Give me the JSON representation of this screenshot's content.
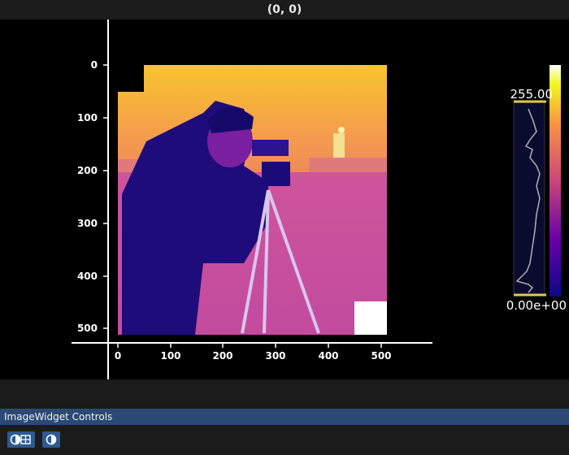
{
  "window": {
    "title": "(0, 0)"
  },
  "image_plot": {
    "x_ticks": [
      "0",
      "100",
      "200",
      "300",
      "400",
      "500"
    ],
    "y_ticks": [
      "0",
      "100",
      "200",
      "300",
      "400",
      "500"
    ],
    "colormap": "plasma"
  },
  "histogram": {
    "vmax_label": "255.00",
    "vmin_label": "0.00e+00"
  },
  "controls": {
    "title": "ImageWidget Controls",
    "buttons": [
      {
        "icon": "contrast-grid-icon"
      },
      {
        "icon": "contrast-icon"
      }
    ]
  },
  "colors": {
    "controls_header": "#2a4a73",
    "button": "#2d5a8f",
    "marker": "#e5c84a"
  }
}
